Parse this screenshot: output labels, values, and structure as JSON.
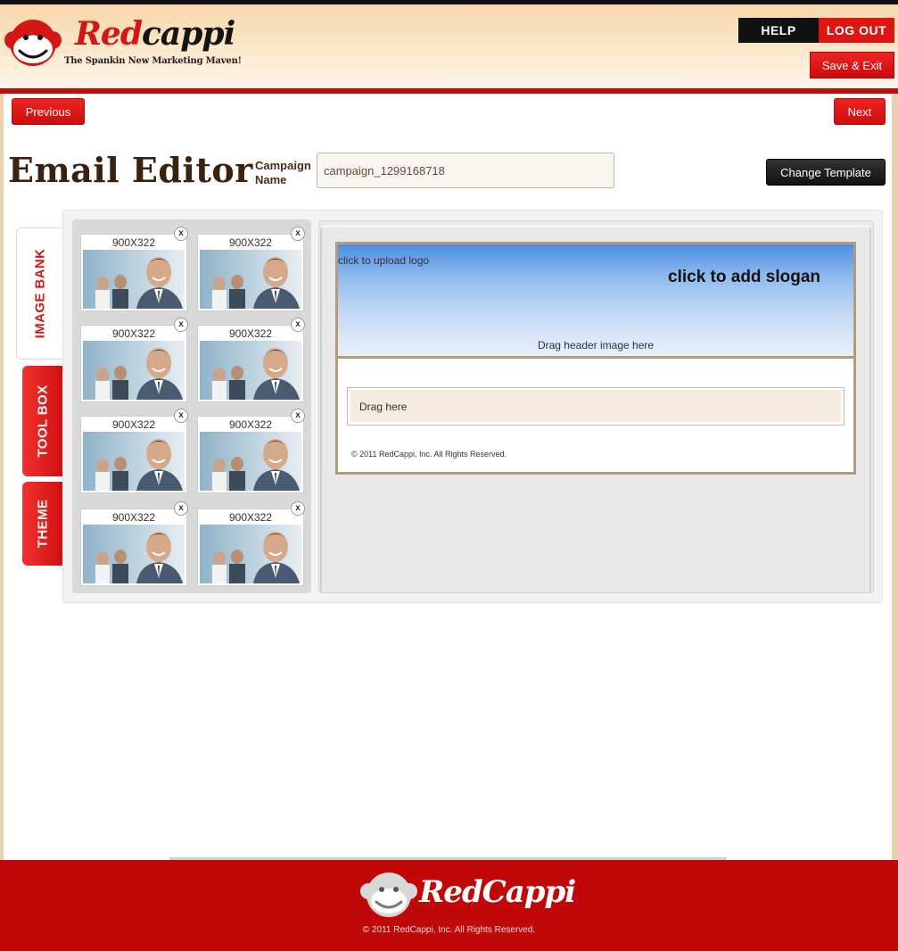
{
  "brand": {
    "name_part1": "Red",
    "name_part2": "cappi",
    "tagline": "The Spankin New Marketing Maven!",
    "footer_name": "RedCappi"
  },
  "header": {
    "help_label": "HELP",
    "logout_label": "LOG OUT",
    "save_exit_label": "Save & Exit"
  },
  "nav": {
    "previous_label": "Previous",
    "next_label": "Next"
  },
  "page": {
    "title": "Email Editor",
    "campaign_label": "Campaign Name",
    "campaign_value": "campaign_1299168718",
    "change_template_label": "Change Template"
  },
  "tabs": [
    {
      "label": "IMAGE BANK",
      "active": true
    },
    {
      "label": "TOOL BOX",
      "active": false
    },
    {
      "label": "THEME",
      "active": false
    }
  ],
  "image_bank": {
    "close_label": "x",
    "images": [
      {
        "label": "900X322"
      },
      {
        "label": "900X322"
      },
      {
        "label": "900X322"
      },
      {
        "label": "900X322"
      },
      {
        "label": "900X322"
      },
      {
        "label": "900X322"
      },
      {
        "label": "900X322"
      },
      {
        "label": "900X322"
      }
    ]
  },
  "email": {
    "upload_logo": "click to upload logo",
    "slogan": "click to add slogan",
    "drag_header": "Drag header image here",
    "drag_here": "Drag here",
    "copyright": "© 2011 RedCappi, Inc. All Rights Reserved."
  },
  "footer": {
    "copyright": "© 2011 RedCappi, Inc. All Rights Reserved."
  },
  "colors": {
    "brand_red": "#d31616",
    "header_cream": "#fbe8cc",
    "footer_red": "#c10808",
    "email_border": "#b29c7c"
  }
}
